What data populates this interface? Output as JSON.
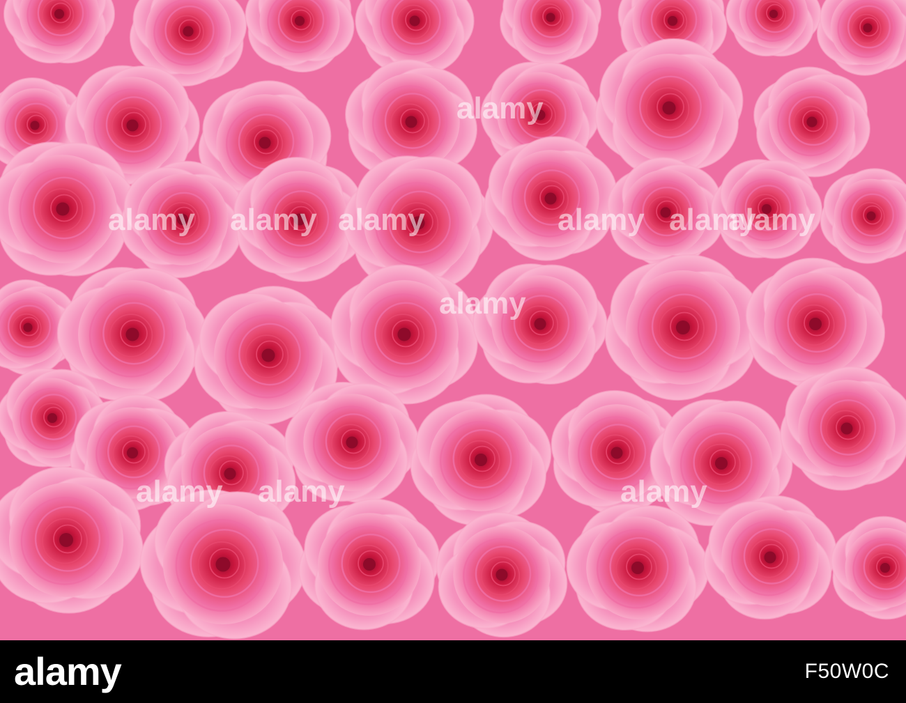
{
  "photo": {
    "subject": "pink roses",
    "colors": {
      "petal_outer": "#f9a9c8",
      "petal_mid": "#f06ea4",
      "petal_inner": "#e8486f",
      "core": "#c8163d",
      "core_dark": "#8e0a2a",
      "background": "#ee6fa3"
    }
  },
  "watermark": {
    "text": "alamy"
  },
  "footer": {
    "logo_text": "alamy",
    "image_id": "F50W0C"
  }
}
